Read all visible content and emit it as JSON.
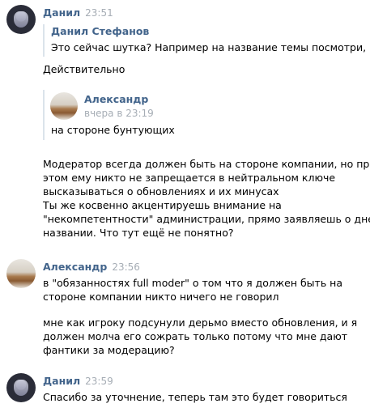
{
  "messages": [
    {
      "author": "Данил",
      "time": "23:51",
      "quote": {
        "author": "Данил Стефанов",
        "text": "Это сейчас шутка? Например на название темы посмотри, ..."
      },
      "text": "Действительно",
      "nested_quote": {
        "author": "Александр",
        "time": "вчера в 23:19",
        "text": "на стороне бунтующих"
      },
      "paragraph_lines": [
        "Модератор всегда должен быть на стороне компании, но при",
        "этом ему никто не запрещается в нейтральном ключе",
        "высказываться о обновлениях и их минусах",
        "Ты же косвенно акцентируешь внимание на",
        "\"некомпетентности\" администрации, прямо заявляешь о дне в",
        "названии. Что тут ещё не понятно?"
      ]
    },
    {
      "author": "Александр",
      "time": "23:56",
      "lines": [
        "в \"обязанностях full moder\" о том что я должен быть на",
        "стороне компании никто ничего не говорил"
      ],
      "lines2": [
        "мне как игроку подсунули дерьмо вместо обновления, и я",
        "должен молча его сожрать только потому что мне дают",
        "фантики за модерацию?"
      ]
    },
    {
      "author": "Данил",
      "time": "23:59",
      "text": "Спасибо за уточнение, теперь там это будет говориться"
    }
  ]
}
